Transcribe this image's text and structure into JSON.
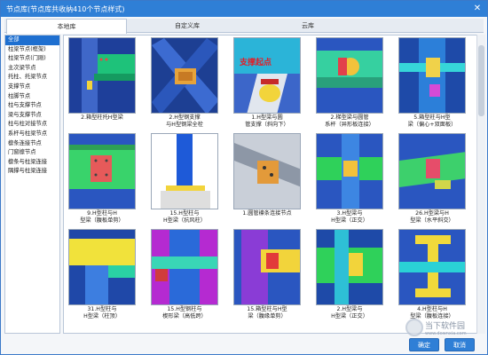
{
  "window": {
    "title": "节点库(节点库共收纳410个节点样式)",
    "close_icon": "close-icon"
  },
  "tabs": [
    {
      "label": "本地库",
      "active": true
    },
    {
      "label": "自定义库",
      "active": false
    },
    {
      "label": "云库",
      "active": false
    }
  ],
  "sidebar": {
    "items": [
      {
        "label": "全部",
        "selected": true
      },
      {
        "label": "柱梁节点(框架)"
      },
      {
        "label": "柱梁节点(门刚)"
      },
      {
        "label": "主次梁节点"
      },
      {
        "label": "托柱、托梁节点"
      },
      {
        "label": "支撑节点"
      },
      {
        "label": "柱脚节点"
      },
      {
        "label": "柱与支撑节点"
      },
      {
        "label": "梁与支撑节点"
      },
      {
        "label": "柱与柱对接节点"
      },
      {
        "label": "系杆与柱梁节点"
      },
      {
        "label": "檩条连接节点"
      },
      {
        "label": "门窗檩节点"
      },
      {
        "label": "檩条与柱梁连接"
      },
      {
        "label": "隅撑与柱梁连接"
      }
    ]
  },
  "gallery": {
    "cards": [
      {
        "caption1": "2.箱型柱托H型梁",
        "caption2": "",
        "palette": "green-box"
      },
      {
        "caption1": "2.H型钢支撑",
        "caption2": "与H型钢梁全栓",
        "palette": "diagonal"
      },
      {
        "caption1": "1.H型梁与圆",
        "caption2": "管支撑（斜向下）",
        "palette": "pipe",
        "overlay": "支撑起点"
      },
      {
        "caption1": "2.梯型梁与圆管",
        "caption2": "系杆（异形板连接）",
        "palette": "round"
      },
      {
        "caption1": "5.箱型柱与H型",
        "caption2": "梁（偏心+双面板）",
        "palette": "cyan-box"
      },
      {
        "caption1": "9.H型柱与H",
        "caption2": "型梁（腹板单剪）",
        "palette": "green-web"
      },
      {
        "caption1": "15.H型柱与",
        "caption2": "H型梁（抗风柱）",
        "palette": "tall"
      },
      {
        "caption1": "1.圆管檩条连接节点",
        "caption2": "",
        "palette": "gray-beam"
      },
      {
        "caption1": "3.H型梁与",
        "caption2": "H型梁（正交）",
        "palette": "green-cross"
      },
      {
        "caption1": "26.H型梁与H",
        "caption2": "型梁（水平斜交）",
        "palette": "skew"
      },
      {
        "caption1": "31.H型柱与",
        "caption2": "H型梁（柱顶）",
        "palette": "yellow-top"
      },
      {
        "caption1": "15.H型钢柱与",
        "caption2": "楔形梁（高低跨）",
        "palette": "blue-tall"
      },
      {
        "caption1": "15.箱型柱与H型",
        "caption2": "梁（腹缘单剪）",
        "palette": "purple"
      },
      {
        "caption1": "2.H型梁与",
        "caption2": "H型梁（正交）",
        "palette": "green-right"
      },
      {
        "caption1": "4.H型柱与H",
        "caption2": "型梁（腹板连接）",
        "palette": "yellow-i"
      }
    ]
  },
  "footer": {
    "ok_label": "确定",
    "cancel_label": "取消"
  },
  "watermark": {
    "text": "当下软件园",
    "sub": "www.downxia.com"
  },
  "colors": {
    "titlebar": "#2f7fd6",
    "selected": "#1e6fd0",
    "thumb_bg": "#1d4ea8"
  }
}
